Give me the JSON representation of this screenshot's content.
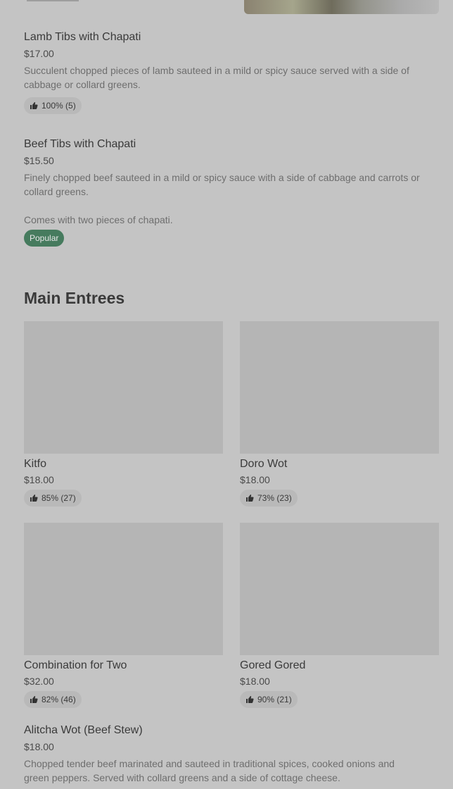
{
  "items_top": [
    {
      "name": "Lamb Tibs with Chapati",
      "price": "$17.00",
      "description": "Succulent chopped pieces of lamb sauteed in a mild or spicy sauce served with a side of cabbage or collard greens.",
      "rating": "100% (5)"
    },
    {
      "name": "Beef Tibs with Chapati",
      "price": "$15.50",
      "description": "Finely chopped beef sauteed in a mild or spicy sauce with a side of cabbage and carrots or collard greens.",
      "description_extra": "Comes with two pieces of chapati.",
      "badge": "Popular"
    }
  ],
  "section": {
    "title": "Main Entrees"
  },
  "cards": [
    {
      "name": "Kitfo",
      "price": "$18.00",
      "rating": "85% (27)"
    },
    {
      "name": "Doro Wot",
      "price": "$18.00",
      "rating": "73% (23)"
    },
    {
      "name": "Combination for Two",
      "price": "$32.00",
      "rating": "82% (46)"
    },
    {
      "name": "Gored Gored",
      "price": "$18.00",
      "rating": "90% (21)"
    }
  ],
  "bottom_item": {
    "name": "Alitcha Wot (Beef Stew)",
    "price": "$18.00",
    "description": "Chopped tender beef marinated and sauteed in traditional spices, cooked onions and green peppers. Served with collard greens and a side of cottage cheese."
  },
  "colors": {
    "background": "#c4c4c4",
    "popular_badge": "#467b5e",
    "image_placeholder": "#b5b5b5"
  }
}
